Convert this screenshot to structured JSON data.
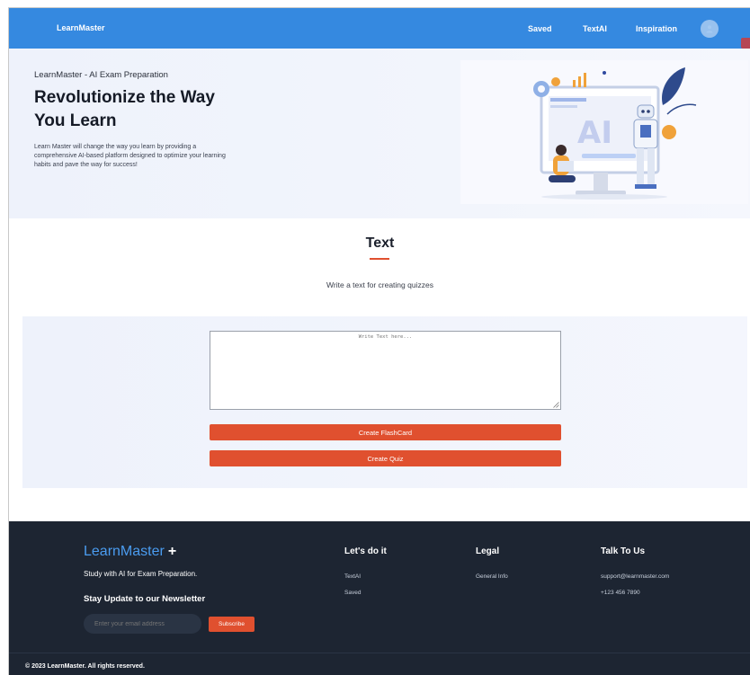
{
  "nav": {
    "brand": "LearnMaster",
    "links": [
      "Saved",
      "TextAI",
      "Inspiration"
    ]
  },
  "hero": {
    "kicker": "LearnMaster - AI Exam Preparation",
    "title": "Revolutionize the Way You Learn",
    "description": "Learn Master will change the way you learn by providing a comprehensive AI-based platform designed to optimize your learning habits and pave the way for success!",
    "art_text": "AI"
  },
  "text_section": {
    "title": "Text",
    "subtitle": "Write a text for creating quizzes",
    "textarea_placeholder": "Write Text here...",
    "buttons": {
      "flashcard": "Create FlashCard",
      "quiz": "Create Quiz"
    }
  },
  "footer": {
    "logo": "LearnMaster",
    "logo_plus": "+",
    "tagline": "Study with AI for Exam Preparation.",
    "newsletter_title": "Stay Update to our Newsletter",
    "email_placeholder": "Enter your email address",
    "subscribe": "Subscribe",
    "columns": [
      {
        "title": "Let's do it",
        "links": [
          "TextAI",
          "Saved"
        ]
      },
      {
        "title": "Legal",
        "links": [
          "General Info"
        ]
      },
      {
        "title": "Talk To Us",
        "links": [
          "support@learnmaster.com",
          "+123 456 7890"
        ]
      }
    ],
    "copyright": "© 2023 LearnMaster. All rights reserved."
  },
  "colors": {
    "nav": "#3589e0",
    "accent": "#e0502f",
    "footer": "#1d2532",
    "hero_bg": "#eef2fb"
  },
  "icons": [
    "user-icon",
    "resize-grip-icon"
  ]
}
